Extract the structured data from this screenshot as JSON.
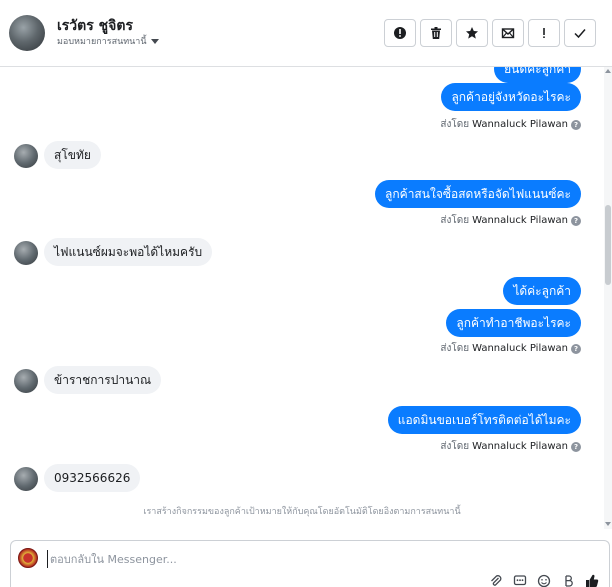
{
  "header": {
    "name": "เรวัตร ชูจิตร",
    "assign_label": "มอบหมายการสนทนานี้",
    "actions": [
      {
        "icon": "alert-circle-icon"
      },
      {
        "icon": "trash-icon"
      },
      {
        "icon": "star-icon"
      },
      {
        "icon": "envelope-icon"
      },
      {
        "icon": "exclamation-icon"
      },
      {
        "icon": "check-icon"
      }
    ]
  },
  "messages": {
    "out_cut": "ยินดีค่ะลูกค้า",
    "out_1": "ลูกค้าอยู่จังหวัดอะไรคะ",
    "sent_prefix": "ส่งโดย",
    "sent_name": "Wannaluck Pilawan",
    "in_1": "สุโขทัย",
    "out_2": "ลูกค้าสนใจซื้อสดหรือจัดไฟแนนซ์คะ",
    "in_2": "ไฟแนนซ์ผมจะพอได้ไหมครับ",
    "out_3a": "ได้ค่ะลูกค้า",
    "out_3b": "ลูกค้าทำอาชีพอะไรคะ",
    "in_3": "ข้าราชการปานาณ",
    "out_4": "แอดมินขอเบอร์โทรติดต่อได้ไมคะ",
    "in_4": "0932566626",
    "event": "เราสร้างกิจกรรมของลูกค้าเป้าหมายให้กับคุณโดยอัตโนมัติโดยอิงตามการสนทนานี้"
  },
  "composer": {
    "placeholder": "ตอบกลับใน Messenger..."
  },
  "colors": {
    "outgoing_bubble": "#0a7cff",
    "incoming_bubble": "#f0f2f5"
  }
}
